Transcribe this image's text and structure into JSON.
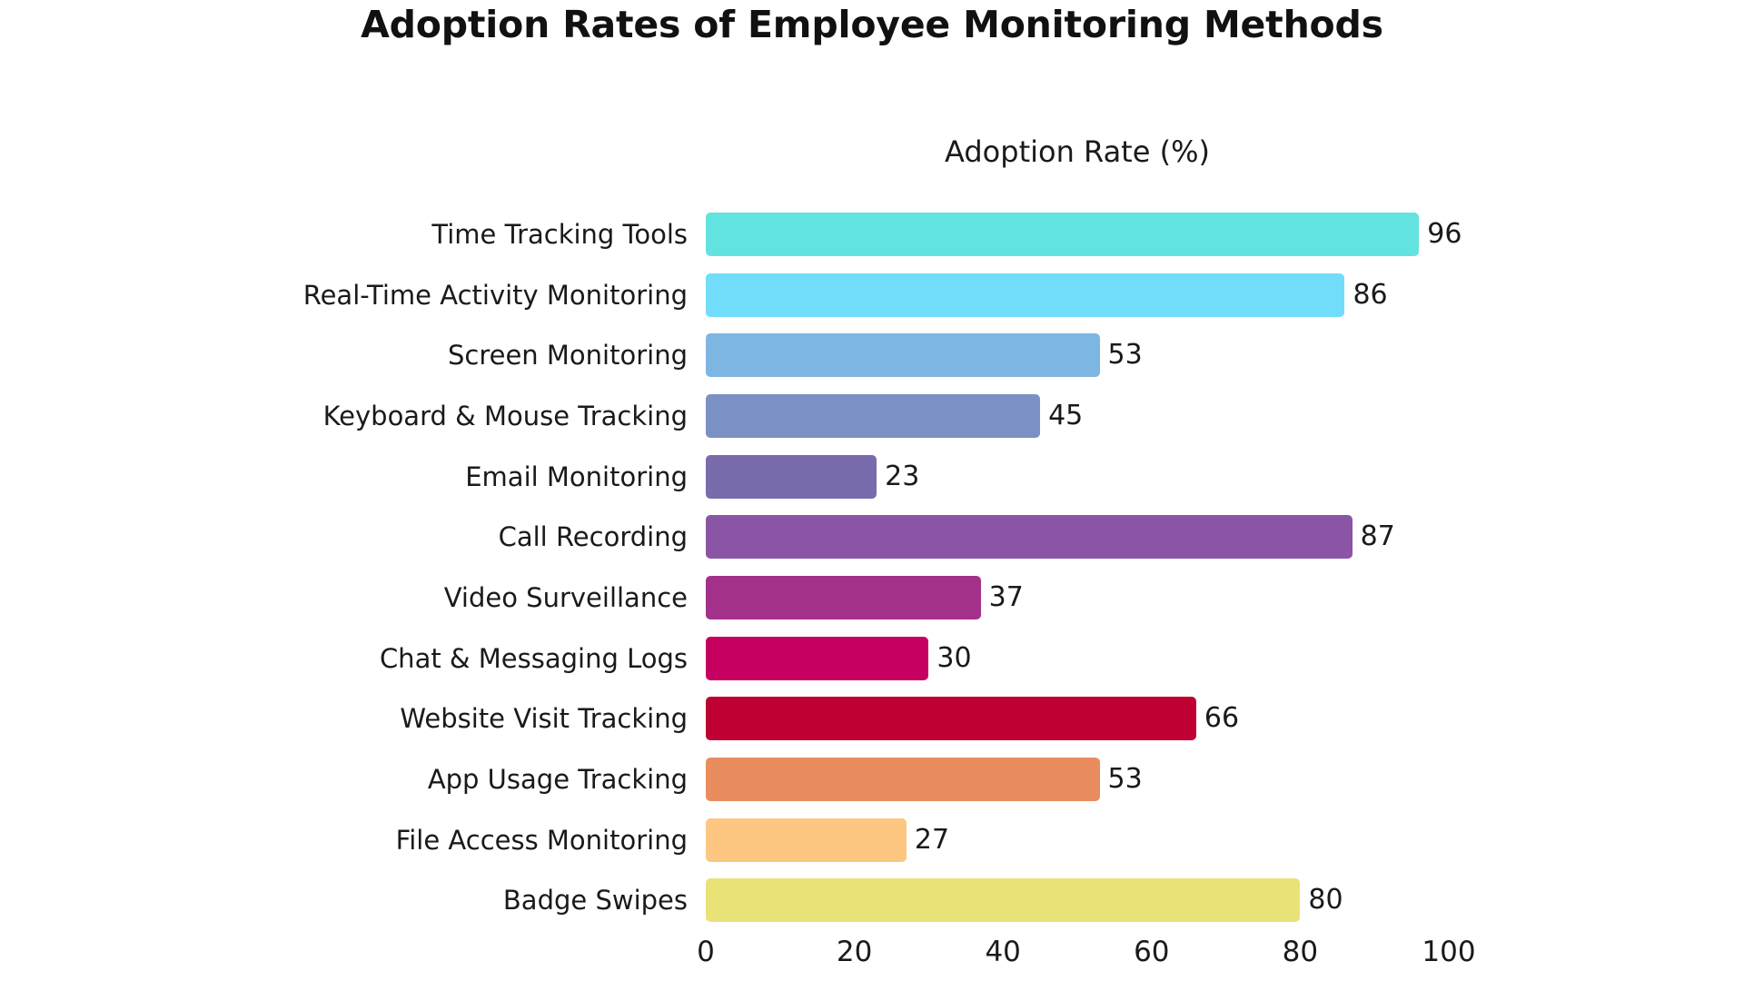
{
  "chart_data": {
    "type": "bar",
    "orientation": "horizontal",
    "title": "Adoption Rates of Employee Monitoring Methods",
    "subtitle": "Adoption Rate (%)",
    "xlabel": "",
    "ylabel": "",
    "xlim": [
      0,
      100
    ],
    "xticks": [
      "0",
      "20",
      "40",
      "60",
      "80",
      "100"
    ],
    "xtick_values": [
      0,
      20,
      40,
      60,
      80,
      100
    ],
    "grid": false,
    "legend": "none",
    "background_color": "#ffffff",
    "text_color": "#1a1a1a",
    "categories": [
      "Time Tracking Tools",
      "Real-Time Activity Monitoring",
      "Screen Monitoring",
      "Keyboard & Mouse Tracking",
      "Email Monitoring",
      "Call Recording",
      "Video Surveillance",
      "Chat & Messaging Logs",
      "Website Visit Tracking",
      "App Usage Tracking",
      "File Access Monitoring",
      "Badge Swipes"
    ],
    "values": [
      96,
      86,
      53,
      45,
      23,
      87,
      37,
      30,
      66,
      53,
      27,
      80
    ],
    "value_labels": [
      "96",
      "86",
      "53",
      "45",
      "23",
      "87",
      "37",
      "30",
      "66",
      "53",
      "27",
      "80"
    ],
    "colors": [
      "#63E3E0",
      "#72DCFB",
      "#7EB6E2",
      "#7B90C4",
      "#7A6BAC",
      "#8B55A5",
      "#A33189",
      "#C50060",
      "#BE0032",
      "#E98C5E",
      "#FDC781",
      "#E9E377"
    ]
  }
}
